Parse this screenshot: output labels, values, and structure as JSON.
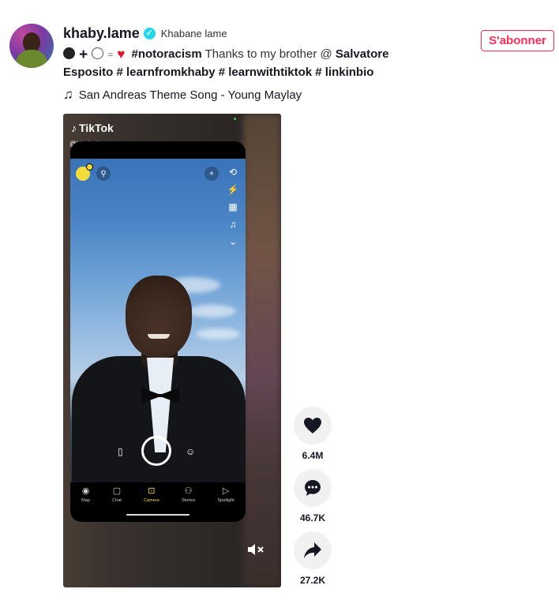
{
  "author": {
    "username": "khaby.lame",
    "nickname": "Khabane lame",
    "follow_label": "S'abonner"
  },
  "description": {
    "hashtag1": "#notoracism",
    "text1": "Thanks to my brother @",
    "mention": "Salvatore",
    "line2": "Esposito # learnfromkhaby # learnwithtiktok # linkinbio"
  },
  "music": {
    "title": "San Andreas Theme Song - Young Maylay"
  },
  "video": {
    "watermark_logo": "TikTok",
    "watermark_handle": "@khaby.lame",
    "nav": [
      "Map",
      "Chat",
      "Camera",
      "Stories",
      "Spotlight"
    ],
    "active_nav": "Camera"
  },
  "actions": {
    "likes": "6.4M",
    "comments": "46.7K",
    "shares": "27.2K"
  },
  "colors": {
    "accent": "#fe2c55",
    "verified": "#20d5ec",
    "snap_yellow": "#f2dc3a"
  }
}
